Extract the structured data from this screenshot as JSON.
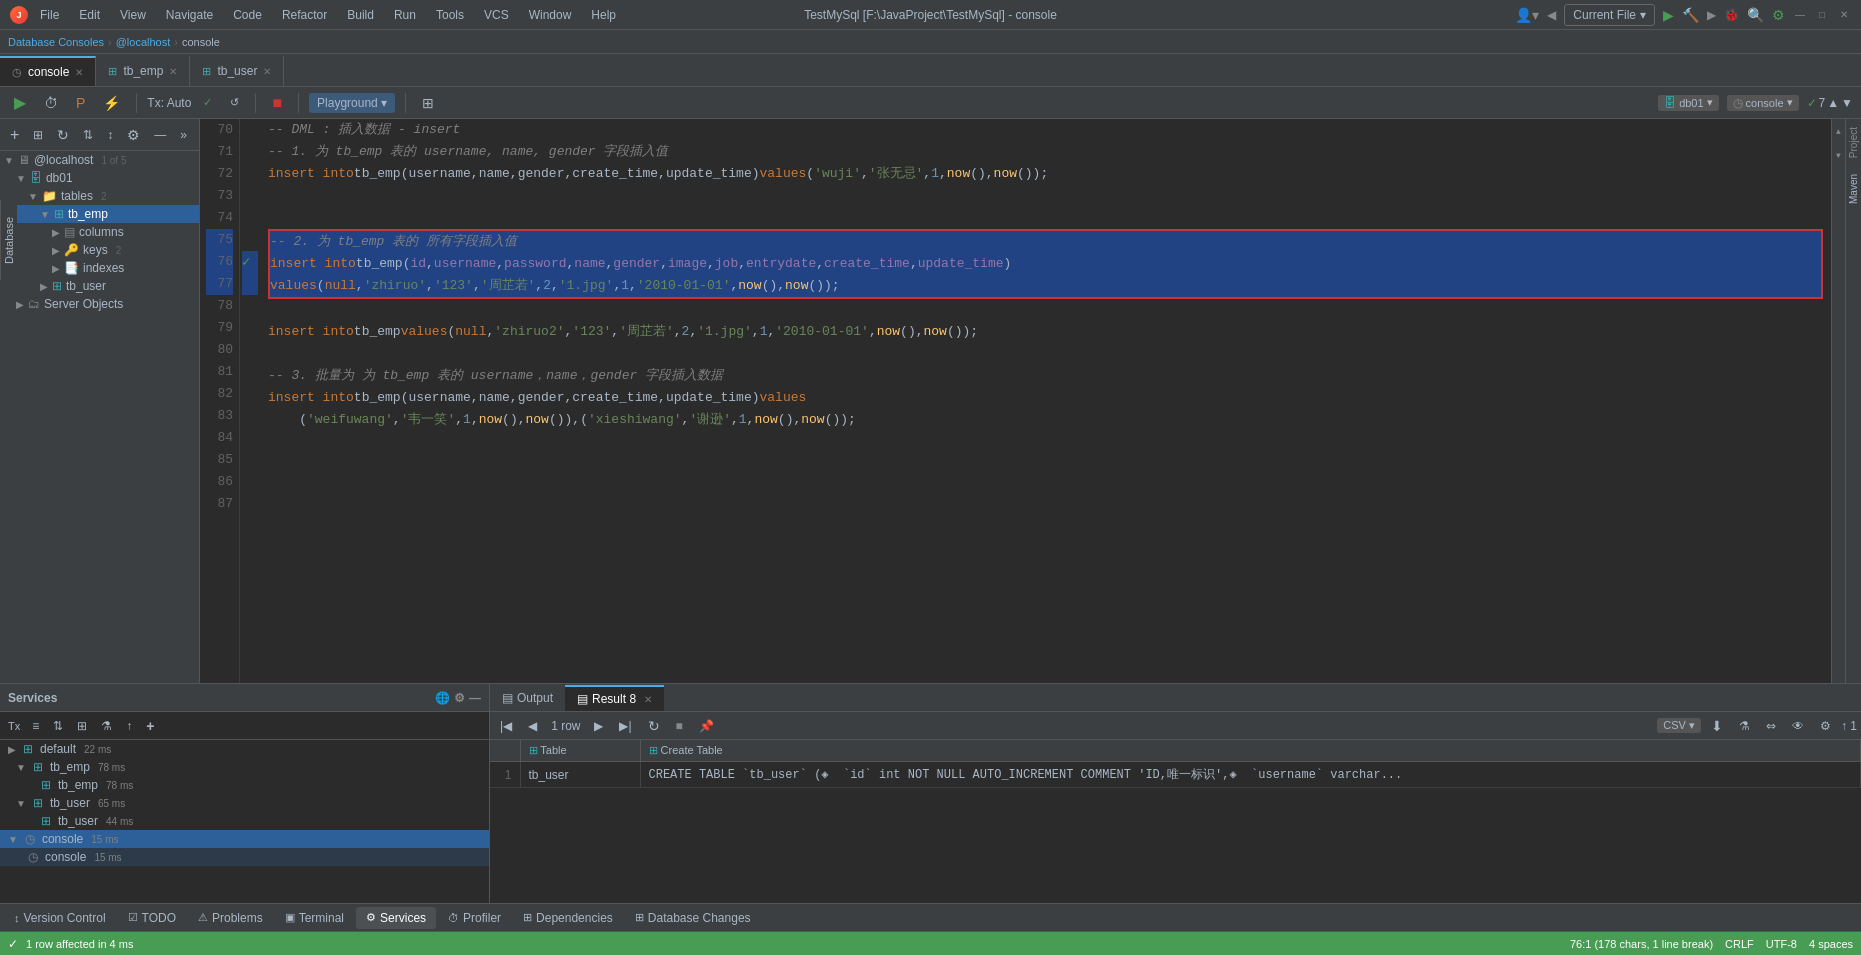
{
  "titlebar": {
    "title": "TestMySql [F:\\JavaProject\\TestMySql] - console",
    "menus": [
      "File",
      "Edit",
      "View",
      "Navigate",
      "Code",
      "Refactor",
      "Build",
      "Run",
      "Tools",
      "VCS",
      "Window",
      "Help"
    ]
  },
  "breadcrumb": {
    "items": [
      "Database Consoles",
      "@localhost",
      "console"
    ]
  },
  "tabs": [
    {
      "id": "console",
      "label": "console",
      "icon": "◷",
      "active": true
    },
    {
      "id": "tb_emp",
      "label": "tb_emp",
      "icon": "⊞",
      "active": false
    },
    {
      "id": "tb_user",
      "label": "tb_user",
      "icon": "⊞",
      "active": false
    }
  ],
  "editor_toolbar": {
    "run_label": "▶",
    "tx_label": "Tx: Auto",
    "commit_label": "✓",
    "rollback_label": "↺",
    "stop_label": "■",
    "playground_label": "Playground ▾",
    "db_label": "db01",
    "console_label": "console",
    "lines_label": "✓ 7"
  },
  "sidebar": {
    "title": "Database",
    "host": "@localhost",
    "host_count": "1 of 5",
    "db": "db01",
    "tables_label": "tables",
    "tables_count": "2",
    "tb_emp_label": "tb_emp",
    "columns_label": "columns",
    "keys_label": "keys",
    "keys_count": "2",
    "indexes_label": "indexes",
    "tb_user_label": "tb_user",
    "server_objects_label": "Server Objects"
  },
  "code_lines": [
    {
      "num": 70,
      "content": "-- DML : 插入数据 - insert",
      "type": "comment"
    },
    {
      "num": 71,
      "content": "-- 1. 为 tb_emp 表的 username, name, gender 字段插入值",
      "type": "comment"
    },
    {
      "num": 72,
      "content": "insert into tb_emp(username,name,gender,create_time,update_time) values ('wuji','张无忌',1,now(),now());",
      "type": "code"
    },
    {
      "num": 73,
      "content": "",
      "type": "empty"
    },
    {
      "num": 74,
      "content": "",
      "type": "empty"
    },
    {
      "num": 75,
      "content": "-- 2. 为 tb_emp 表的 所有字段插入值",
      "type": "comment",
      "selected": true
    },
    {
      "num": 76,
      "content": "insert into tb_emp(id, username, password, name, gender, image, job, entrydate, create_time, update_time)",
      "type": "code",
      "selected": true,
      "has_check": true
    },
    {
      "num": 77,
      "content": "values (null,'zhiruo','123','周芷若',2,'1.jpg',1,'2010-01-01',now(),now());",
      "type": "code",
      "selected": true
    },
    {
      "num": 78,
      "content": "",
      "type": "empty"
    },
    {
      "num": 79,
      "content": "insert into tb_emp values (null,'zhiruo2','123','周芷若',2,'1.jpg',1,'2010-01-01',now(),now());",
      "type": "code"
    },
    {
      "num": 80,
      "content": "",
      "type": "empty"
    },
    {
      "num": 81,
      "content": "-- 3. 批量为 为 tb_emp 表的 username，name，gender 字段插入数据",
      "type": "comment"
    },
    {
      "num": 82,
      "content": "insert into tb_emp(username,name,gender,create_time,update_time) values",
      "type": "code"
    },
    {
      "num": 83,
      "content": "    ('weifuwang','韦一笑',1,now(),now()),('xieshiwang','谢逊',1,now(),now());",
      "type": "code"
    },
    {
      "num": 84,
      "content": "",
      "type": "empty"
    },
    {
      "num": 85,
      "content": "",
      "type": "empty"
    },
    {
      "num": 86,
      "content": "",
      "type": "empty"
    },
    {
      "num": 87,
      "content": "",
      "type": "empty"
    }
  ],
  "services": {
    "title": "Services",
    "items": [
      {
        "label": "default",
        "time": "22 ms",
        "indent": 0,
        "icon": "⊞"
      },
      {
        "label": "tb_emp",
        "time": "78 ms",
        "indent": 1,
        "icon": "⊞",
        "expanded": true
      },
      {
        "label": "tb_emp",
        "time": "78 ms",
        "indent": 2,
        "icon": "⊞"
      },
      {
        "label": "tb_user",
        "time": "65 ms",
        "indent": 1,
        "icon": "⊞",
        "expanded": true
      },
      {
        "label": "tb_user",
        "time": "44 ms",
        "indent": 2,
        "icon": "⊞"
      },
      {
        "label": "console",
        "time": "15 ms",
        "indent": 0,
        "icon": "◷",
        "expanded": true,
        "selected": true
      },
      {
        "label": "console",
        "time": "15 ms",
        "indent": 1,
        "icon": "◷"
      }
    ]
  },
  "output_tabs": [
    {
      "label": "Output",
      "icon": "▤",
      "active": false
    },
    {
      "label": "Result 8",
      "icon": "▤",
      "active": true
    }
  ],
  "result_table": {
    "count_label": "1 row",
    "csv_label": "CSV ▾",
    "columns": [
      "Table",
      "Create Table"
    ],
    "rows": [
      {
        "num": "1",
        "table": "tb_user",
        "create": "CREATE TABLE `tb_user` (◈  `id` int NOT NULL AUTO_INCREMENT COMMENT 'ID,唯一标识', ◈  `username` varchar..."
      }
    ]
  },
  "bottom_tabs": [
    {
      "label": "Version Control",
      "icon": "↕",
      "active": false
    },
    {
      "label": "TODO",
      "icon": "☑",
      "active": false
    },
    {
      "label": "Problems",
      "icon": "⚠",
      "active": false
    },
    {
      "label": "Terminal",
      "icon": "▣",
      "active": false
    },
    {
      "label": "Services",
      "icon": "⚙",
      "active": true
    },
    {
      "label": "Profiler",
      "icon": "⏱",
      "active": false
    },
    {
      "label": "Dependencies",
      "icon": "⊞",
      "active": false
    },
    {
      "label": "Database Changes",
      "icon": "⊞",
      "active": false
    }
  ],
  "status_bar": {
    "left": "1 row affected in 4 ms",
    "position": "76:1 (178 chars, 1 line break)",
    "line_ending": "CRLF",
    "encoding": "UTF-8",
    "indent": "4 spaces"
  }
}
